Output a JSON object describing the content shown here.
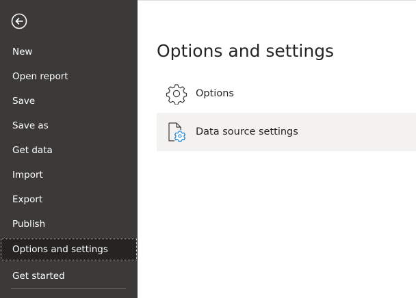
{
  "sidebar": {
    "back_icon": "back-arrow-icon",
    "items": [
      {
        "label": "New"
      },
      {
        "label": "Open report"
      },
      {
        "label": "Save"
      },
      {
        "label": "Save as"
      },
      {
        "label": "Get data"
      },
      {
        "label": "Import"
      },
      {
        "label": "Export"
      },
      {
        "label": "Publish"
      },
      {
        "label": "Options and settings",
        "selected": true
      },
      {
        "label": "Get started"
      }
    ],
    "background": "#3b3a39",
    "selected_background": "#252423"
  },
  "main": {
    "title": "Options and settings",
    "options": [
      {
        "label": "Options",
        "icon": "gear-icon"
      },
      {
        "label": "Data source settings",
        "icon": "document-gear-icon",
        "hovered": true
      }
    ],
    "accent": "#0078d4"
  }
}
